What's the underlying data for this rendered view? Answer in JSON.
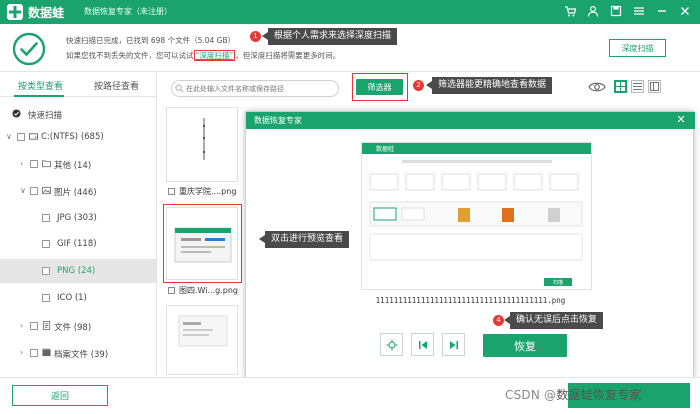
{
  "titlebar": {
    "app_name": "数据蛙",
    "subtitle": "数据恢复专家（未注册）",
    "icons": [
      "cart-icon",
      "user-icon",
      "register-icon",
      "menu-icon",
      "minimize-icon",
      "close-icon"
    ]
  },
  "scan": {
    "line1": "快速扫描已完成，已找到 698 个文件（5.04 GB）",
    "line2_prefix": "如果您找不到丢失的文件，您可以试试",
    "line2_link": "“深度扫描”",
    "line2_suffix": "，但深度扫描将需要更多时间。",
    "deep_scan_button": "深度扫描"
  },
  "callouts": {
    "c1": {
      "num": "1",
      "text": "根据个人需求来选择深度扫描"
    },
    "c2": {
      "num": "2",
      "text": "筛选器能更精确地查看数据"
    },
    "c3": {
      "num": "3",
      "text": "双击进行预览查看"
    },
    "c4": {
      "num": "4",
      "text": "确认无误后点击恢复"
    }
  },
  "sidebar": {
    "tabs": [
      {
        "label": "按类型查看"
      },
      {
        "label": "按路径查看"
      }
    ],
    "items": [
      {
        "label": "快速扫描",
        "level": 0
      },
      {
        "label": "C:(NTFS) (685)",
        "level": 0
      },
      {
        "label": "其他 (14)",
        "level": 1
      },
      {
        "label": "图片 (446)",
        "level": 1
      },
      {
        "label": "JPG (303)",
        "level": 2
      },
      {
        "label": "GIF (118)",
        "level": 2
      },
      {
        "label": "PNG (24)",
        "level": 2,
        "selected": true
      },
      {
        "label": "ICO (1)",
        "level": 2
      },
      {
        "label": "文件 (98)",
        "level": 1
      },
      {
        "label": "档案文件 (39)",
        "level": 1
      }
    ]
  },
  "toolbar": {
    "search_placeholder": "在此处输入文件名称或保存路径",
    "filter_button": "筛选器"
  },
  "thumbs": [
    {
      "label": "重庆学院....png"
    },
    {
      "label": "图四.Wi...g.png"
    }
  ],
  "dialog": {
    "title": "数据恢复专家",
    "filename": "11111111111111111111111111111111111111.png",
    "recover_button": "恢复",
    "mini_app": "数据蛙",
    "mini_scan_btn": "扫描"
  },
  "bottom": {
    "back_button": "返回"
  },
  "watermark": {
    "prefix": "CSDN @",
    "text": "数据蛙恢复专家"
  },
  "colors": {
    "brand": "#1aa36c",
    "callout_bg": "#4a4a4a",
    "badge": "#e53935"
  }
}
